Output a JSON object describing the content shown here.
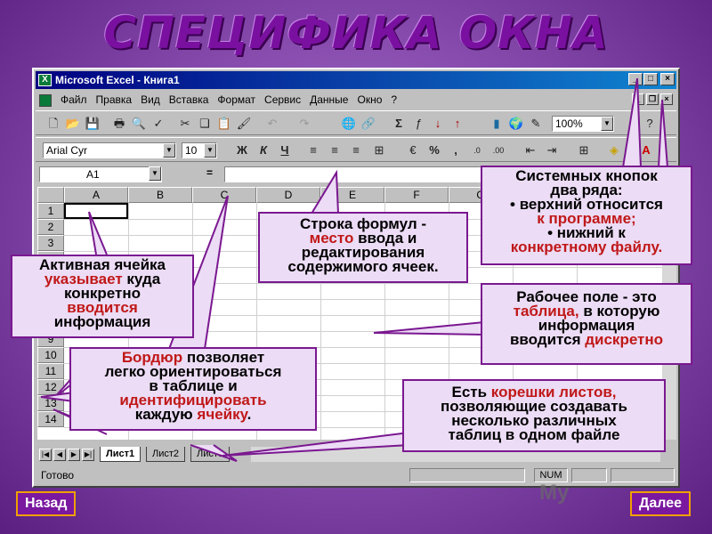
{
  "slide": {
    "title": "СПЕЦИФИКА ОКНА"
  },
  "window": {
    "title": "Microsoft Excel - Книга1",
    "menu": [
      "Файл",
      "Правка",
      "Вид",
      "Вставка",
      "Формат",
      "Сервис",
      "Данные",
      "Окно",
      "?"
    ],
    "font_name": "Arial Cyr",
    "font_size": "10",
    "zoom": "100%",
    "name_box": "A1",
    "formula_equals": "=",
    "format_buttons": [
      "Ж",
      "К",
      "Ч"
    ],
    "columns": [
      "A",
      "B",
      "C",
      "D",
      "E",
      "F",
      "G"
    ],
    "rows": [
      "1",
      "2",
      "3",
      "4",
      "5",
      "6",
      "7",
      "8",
      "9",
      "10",
      "11",
      "12",
      "13",
      "14"
    ],
    "sheet_tabs": [
      "Лист1",
      "Лист2",
      "Лист3"
    ],
    "status": "Готово",
    "num_indicator": "NUM"
  },
  "callouts": {
    "active_cell": {
      "line1": "Активная ячейка",
      "hl1": "указывает",
      "rest1": " куда",
      "line2": "конкретно",
      "hl2": "вводится",
      "line3": "информация"
    },
    "border": {
      "hl1": "Бордюр",
      "rest1": " позволяет",
      "line2": "легко ориентироваться",
      "line3": "в таблице и",
      "hl2": "идентифицировать",
      "pre3": "каждую ",
      "hl3": "ячейку",
      "post3": "."
    },
    "formula": {
      "line1": "Строка формул -",
      "hl1": "место",
      "rest1": " ввода и",
      "line3": "редактирования",
      "line4": "содержимого ячеек."
    },
    "system": {
      "line1": "Системных кнопок",
      "line2": "два ряда:",
      "line3": "• верхний относится",
      "hl1": "к программе;",
      "line4": "• нижний к",
      "hl2": "конкретному файлу."
    },
    "workfield": {
      "line1": "Рабочее поле - это",
      "hl1": "таблица,",
      "rest1": " в которую",
      "line3": "информация",
      "pre4": "вводится ",
      "hl2": "дискретно"
    },
    "tabs": {
      "pre1": "Есть ",
      "hl1": "корешки листов,",
      "line2": "позволяющие создавать",
      "line3": "несколько различных",
      "line4": "таблиц в одном файле"
    }
  },
  "nav": {
    "back": "Назад",
    "next": "Далее"
  },
  "logo": "My"
}
